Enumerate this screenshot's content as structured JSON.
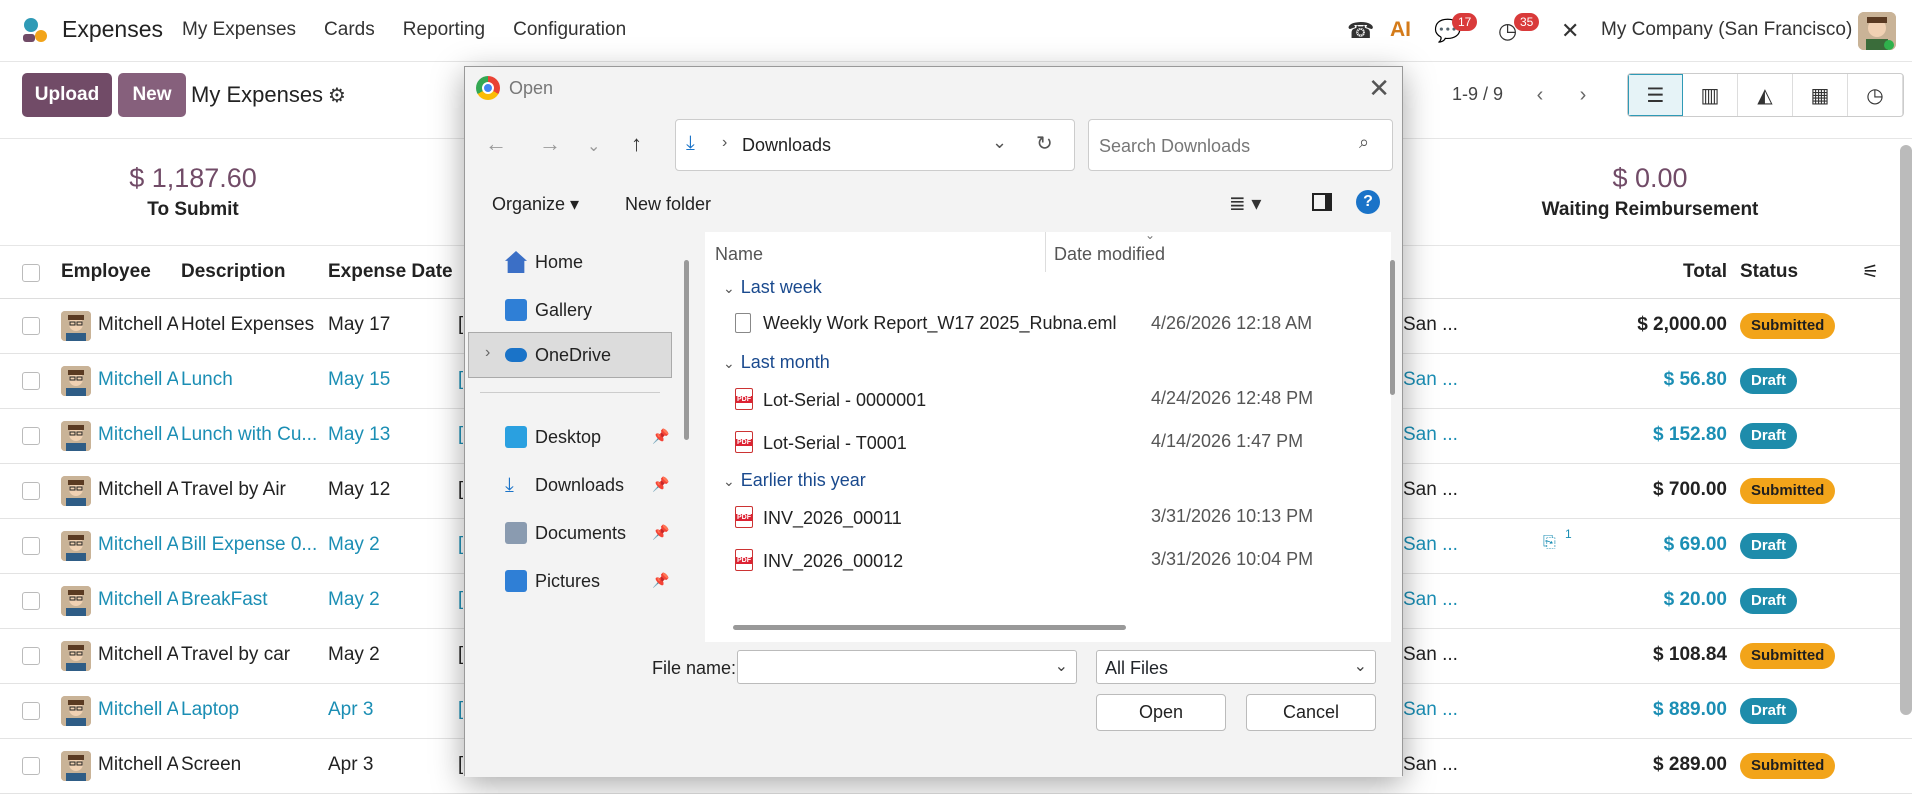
{
  "app": {
    "name": "Expenses",
    "menu": [
      "My Expenses",
      "Cards",
      "Reporting",
      "Configuration"
    ],
    "company": "My Company (San Francisco)",
    "badge_chat": "17",
    "badge_activity": "35"
  },
  "control": {
    "upload": "Upload",
    "new": "New",
    "title": "My Expenses",
    "pager": "1-9 / 9"
  },
  "summary": [
    {
      "value": "$ 1,187.60",
      "label": "To Submit"
    },
    {
      "value": "$ 0.00",
      "label": "Waiting Reimbursement"
    }
  ],
  "table": {
    "headers": {
      "employee": "Employee",
      "description": "Description",
      "date": "Expense Date",
      "total": "Total",
      "status": "Status"
    },
    "rows": [
      {
        "employee": "Mitchell A",
        "description": "Hotel Expenses",
        "date": "May 17",
        "col": "[",
        "company": "San ...",
        "total": "$ 2,000.00",
        "status": "Submitted",
        "kind": "submitted"
      },
      {
        "employee": "Mitchell A",
        "description": "Lunch",
        "date": "May 15",
        "col": "[",
        "company": "San ...",
        "total": "$ 56.80",
        "status": "Draft",
        "kind": "draft"
      },
      {
        "employee": "Mitchell A",
        "description": "Lunch with Cu...",
        "date": "May 13",
        "col": "[",
        "company": "San ...",
        "total": "$ 152.80",
        "status": "Draft",
        "kind": "draft"
      },
      {
        "employee": "Mitchell A",
        "description": "Travel by Air",
        "date": "May 12",
        "col": "[",
        "company": "San ...",
        "total": "$ 700.00",
        "status": "Submitted",
        "kind": "submitted"
      },
      {
        "employee": "Mitchell A",
        "description": "Bill Expense 0...",
        "date": "May 2",
        "col": "[",
        "company": "San ...",
        "total": "$ 69.00",
        "status": "Draft",
        "kind": "draft",
        "attach": "1"
      },
      {
        "employee": "Mitchell A",
        "description": "BreakFast",
        "date": "May 2",
        "col": "[",
        "company": "San ...",
        "total": "$ 20.00",
        "status": "Draft",
        "kind": "draft"
      },
      {
        "employee": "Mitchell A",
        "description": "Travel by car",
        "date": "May 2",
        "col": "[",
        "company": "San ...",
        "total": "$ 108.84",
        "status": "Submitted",
        "kind": "submitted"
      },
      {
        "employee": "Mitchell A",
        "description": "Laptop",
        "date": "Apr 3",
        "col": "[",
        "company": "San ...",
        "total": "$ 889.00",
        "status": "Draft",
        "kind": "draft"
      },
      {
        "employee": "Mitchell A",
        "description": "Screen",
        "date": "Apr 3",
        "col": "[",
        "company": "San ...",
        "total": "$ 289.00",
        "status": "Submitted",
        "kind": "submitted"
      }
    ]
  },
  "dialog": {
    "title": "Open",
    "path": "Downloads",
    "search_placeholder": "Search Downloads",
    "organize": "Organize",
    "new_folder": "New folder",
    "nav": [
      "Home",
      "Gallery",
      "OneDrive",
      "Desktop",
      "Downloads",
      "Documents",
      "Pictures"
    ],
    "columns": {
      "name": "Name",
      "date": "Date modified"
    },
    "groups": [
      {
        "label": "Last week",
        "files": [
          {
            "name": "Weekly Work Report_W17 2025_Rubna.eml",
            "date": "4/26/2026 12:18 AM",
            "type": "eml"
          }
        ]
      },
      {
        "label": "Last month",
        "files": [
          {
            "name": "Lot-Serial - 0000001",
            "date": "4/24/2026 12:48 PM",
            "type": "pdf"
          },
          {
            "name": "Lot-Serial - T0001",
            "date": "4/14/2026 1:47 PM",
            "type": "pdf"
          }
        ]
      },
      {
        "label": "Earlier this year",
        "files": [
          {
            "name": "INV_2026_00011",
            "date": "3/31/2026 10:13 PM",
            "type": "pdf"
          },
          {
            "name": "INV_2026_00012",
            "date": "3/31/2026 10:04 PM",
            "type": "pdf"
          }
        ]
      }
    ],
    "filename_label": "File name:",
    "filename_value": "",
    "filetype": "All Files",
    "open": "Open",
    "cancel": "Cancel"
  },
  "colors": {
    "primary": "#714b67",
    "secondary": "#86607c",
    "draft": "#1e8cab",
    "submitted": "#f2a41a",
    "link": "#1b8eb4"
  }
}
